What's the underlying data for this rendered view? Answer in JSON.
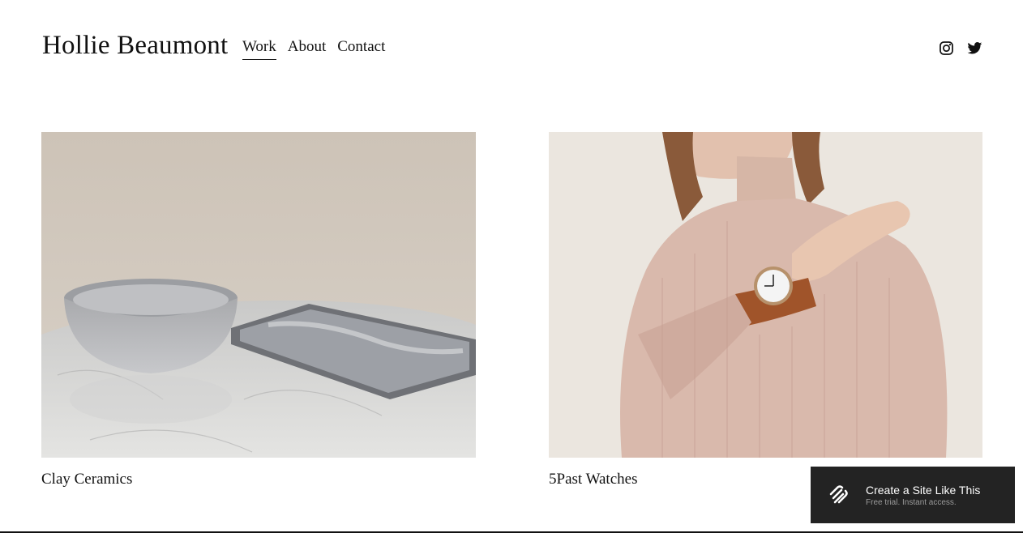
{
  "site": {
    "title": "Hollie Beaumont"
  },
  "nav": {
    "items": [
      {
        "label": "Work",
        "active": true
      },
      {
        "label": "About",
        "active": false
      },
      {
        "label": "Contact",
        "active": false
      }
    ]
  },
  "social": {
    "icons": [
      "instagram-icon",
      "twitter-icon"
    ]
  },
  "projects": [
    {
      "title": "Clay Ceramics"
    },
    {
      "title": "5Past Watches"
    }
  ],
  "promo": {
    "title": "Create a Site Like This",
    "subtitle": "Free trial. Instant access."
  },
  "colors": {
    "text": "#111111",
    "promo_bg": "#232323",
    "promo_sub": "#9a9a9a"
  }
}
